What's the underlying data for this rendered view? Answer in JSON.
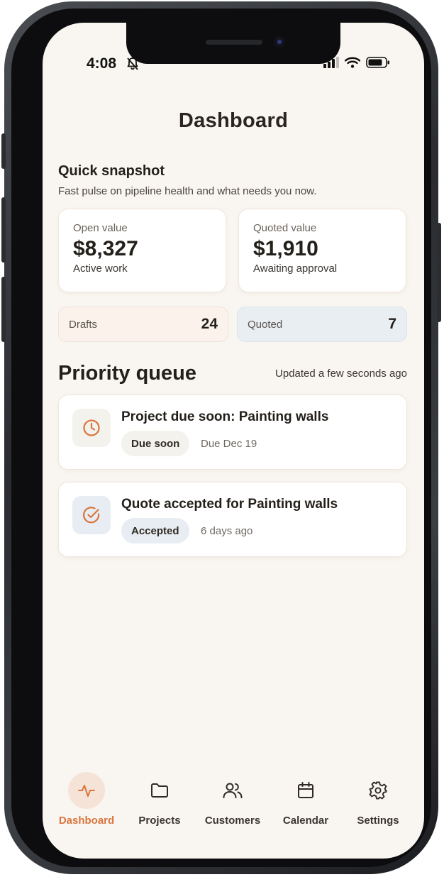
{
  "status_bar": {
    "time": "4:08"
  },
  "header": {
    "title": "Dashboard"
  },
  "snapshot": {
    "title": "Quick snapshot",
    "subtitle": "Fast pulse on pipeline health and what needs you now.",
    "open": {
      "label": "Open value",
      "value": "$8,327",
      "caption": "Active work"
    },
    "quoted": {
      "label": "Quoted value",
      "value": "$1,910",
      "caption": "Awaiting approval"
    },
    "drafts": {
      "label": "Drafts",
      "count": "24"
    },
    "quoted_count": {
      "label": "Quoted",
      "count": "7"
    }
  },
  "priority": {
    "title": "Priority queue",
    "updated": "Updated a few seconds ago",
    "items": [
      {
        "title": "Project due soon: Painting walls",
        "badge": "Due soon",
        "meta": "Due Dec 19",
        "icon": "clock-icon"
      },
      {
        "title": "Quote accepted for Painting walls",
        "badge": "Accepted",
        "meta": "6 days ago",
        "icon": "check-circle-icon"
      }
    ]
  },
  "tabbar": {
    "items": [
      {
        "label": "Dashboard",
        "icon": "activity-icon",
        "active": true
      },
      {
        "label": "Projects",
        "icon": "folder-icon",
        "active": false
      },
      {
        "label": "Customers",
        "icon": "users-icon",
        "active": false
      },
      {
        "label": "Calendar",
        "icon": "calendar-icon",
        "active": false
      },
      {
        "label": "Settings",
        "icon": "gear-icon",
        "active": false
      }
    ]
  },
  "colors": {
    "accent": "#d9763e",
    "background": "#f9f6f1",
    "text": "#231f1a"
  }
}
